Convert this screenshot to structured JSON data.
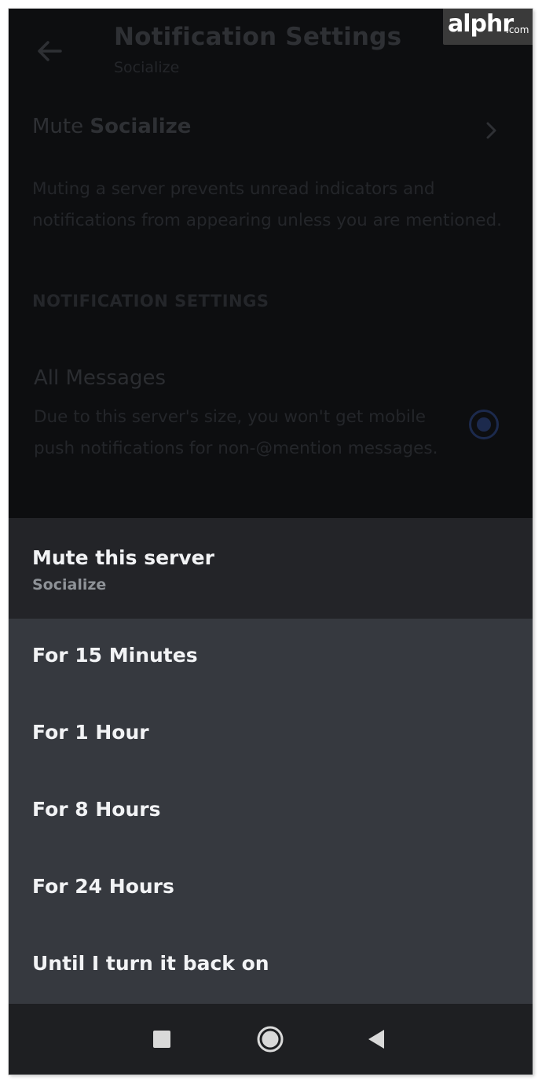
{
  "header": {
    "title": "Notification Settings",
    "subtitle": "Socialize"
  },
  "mute_row": {
    "prefix": "Mute ",
    "server_name": "Socialize",
    "description": "Muting a server prevents unread indicators and notifications from appearing unless you are mentioned."
  },
  "notification_section": {
    "header": "NOTIFICATION SETTINGS",
    "all_messages_label": "All Messages",
    "all_messages_desc": "Due to this server's size, you won't get mobile push notifications for non-@mention messages."
  },
  "sheet": {
    "title": "Mute this server",
    "subtitle": "Socialize",
    "options": [
      {
        "label": "For 15 Minutes"
      },
      {
        "label": "For 1 Hour"
      },
      {
        "label": "For 8 Hours"
      },
      {
        "label": "For 24 Hours"
      },
      {
        "label": "Until I turn it back on"
      }
    ]
  },
  "navbar": {
    "icons": [
      "recents-square-icon",
      "home-circle-icon",
      "back-triangle-icon"
    ]
  },
  "watermark": {
    "brand": "alphr",
    "tld": ".com"
  },
  "colors": {
    "sheet_header_bg": "#232428",
    "options_bg": "#36393f",
    "navbar_bg": "#1e1f22",
    "text_primary": "#f2f3f5",
    "text_muted": "#8e9297"
  }
}
